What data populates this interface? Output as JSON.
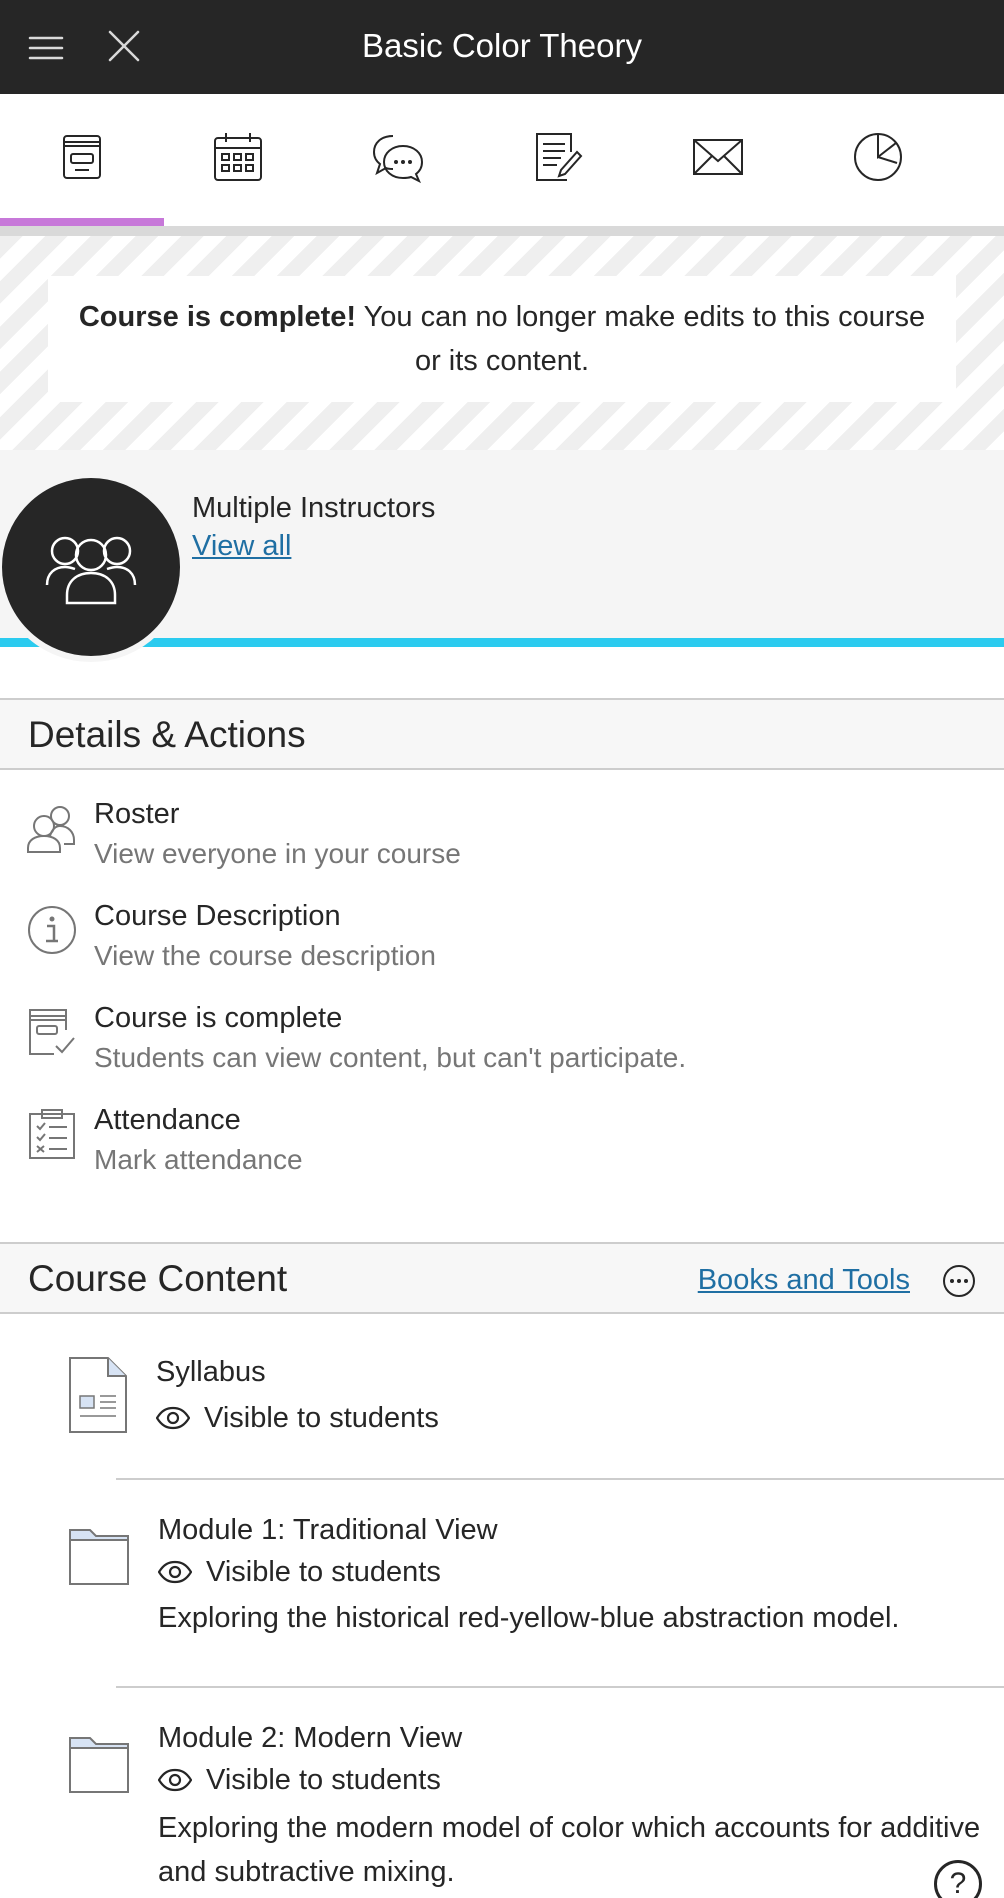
{
  "header": {
    "title": "Basic Color Theory",
    "menu_icon": "hamburger-menu-icon",
    "close_icon": "close-icon",
    "background": "#262626"
  },
  "tabs": [
    {
      "name": "course-outline",
      "icon": "course-outline-icon",
      "active": true
    },
    {
      "name": "calendar",
      "icon": "calendar-icon",
      "active": false
    },
    {
      "name": "discussions",
      "icon": "discussions-icon",
      "active": false
    },
    {
      "name": "gradebook",
      "icon": "gradebook-icon",
      "active": false
    },
    {
      "name": "messages",
      "icon": "messages-icon",
      "active": false
    },
    {
      "name": "analytics",
      "icon": "analytics-icon",
      "active": false
    }
  ],
  "active_tab_color": "#c778d9",
  "banner": {
    "bold": "Course is complete!",
    "text": " You can no longer make edits to this course or its content."
  },
  "instructors": {
    "title": "Multiple Instructors",
    "link": "View all",
    "accent": "#2bcbef"
  },
  "details": {
    "heading": "Details & Actions",
    "items": [
      {
        "title": "Roster",
        "subtitle": "View everyone in your course",
        "icon": "roster-icon"
      },
      {
        "title": "Course Description",
        "subtitle": "View the course description",
        "icon": "info-icon"
      },
      {
        "title": "Course is complete",
        "subtitle": "Students can view content, but can't participate.",
        "icon": "course-complete-icon"
      },
      {
        "title": "Attendance",
        "subtitle": "Mark attendance",
        "icon": "attendance-icon"
      }
    ]
  },
  "content": {
    "heading": "Course Content",
    "books_link": "Books and Tools",
    "items": [
      {
        "title": "Syllabus",
        "visibility": "Visible to students",
        "description": "",
        "icon": "document-icon"
      },
      {
        "title": "Module 1: Traditional View",
        "visibility": "Visible to students",
        "description": "Exploring the historical red-yellow-blue abstraction model.",
        "icon": "folder-icon"
      },
      {
        "title": "Module 2: Modern View",
        "visibility": "Visible to students",
        "description": "Exploring the modern model of color which accounts for additive and subtractive mixing.",
        "icon": "folder-icon"
      }
    ]
  },
  "help": {
    "label": "?"
  }
}
